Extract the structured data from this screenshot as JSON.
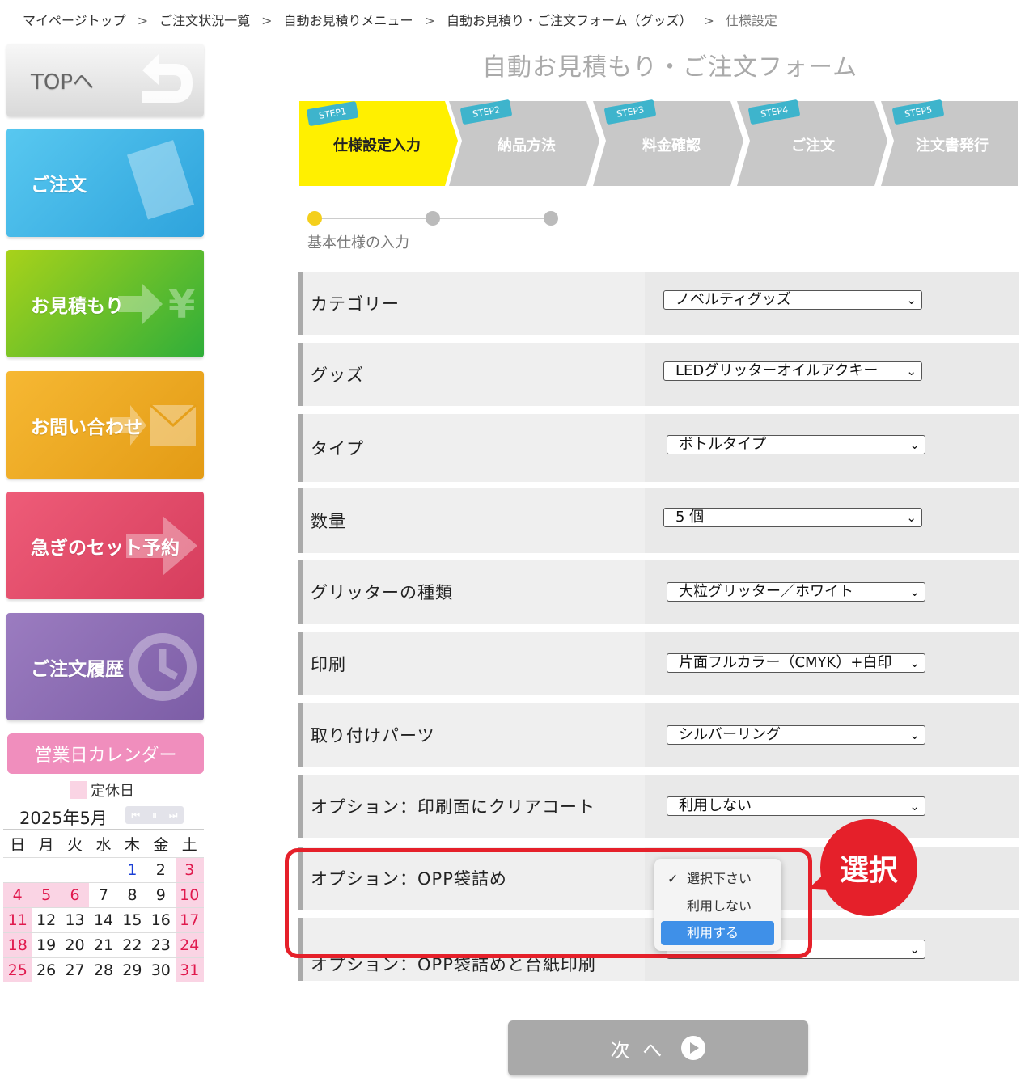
{
  "breadcrumb": {
    "items": [
      "マイページトップ",
      "ご注文状況一覧",
      "自動お見積りメニュー",
      "自動お見積り・ご注文フォーム（グッズ）"
    ],
    "current": "仕様設定",
    "separator": ">"
  },
  "sidebar": {
    "top": "TOPへ",
    "order": "ご注文",
    "quote": "お見積もり",
    "contact": "お問い合わせ",
    "rush": "急ぎのセット予約",
    "history": "ご注文履歴"
  },
  "calendar": {
    "title": "営業日カレンダー",
    "legend": "定休日",
    "month": "2025年5月",
    "nav_icons": [
      "rewind-icon",
      "pause-icon",
      "forward-icon"
    ],
    "weekdays": [
      "日",
      "月",
      "火",
      "水",
      "木",
      "金",
      "土"
    ],
    "weeks": [
      [
        "",
        "",
        "",
        "",
        "1",
        "2",
        "3"
      ],
      [
        "4",
        "5",
        "6",
        "7",
        "8",
        "9",
        "10"
      ],
      [
        "11",
        "12",
        "13",
        "14",
        "15",
        "16",
        "17"
      ],
      [
        "18",
        "19",
        "20",
        "21",
        "22",
        "23",
        "24"
      ],
      [
        "25",
        "26",
        "27",
        "28",
        "29",
        "30",
        "31"
      ]
    ],
    "holidays": [
      "3",
      "4",
      "5",
      "6",
      "10",
      "11",
      "17",
      "18",
      "24",
      "25",
      "31"
    ],
    "blue_days": [
      "1"
    ]
  },
  "form": {
    "title": "自動お見積もり・ご注文フォーム",
    "steps": [
      {
        "tag": "STEP1",
        "label": "仕様設定入力",
        "active": true
      },
      {
        "tag": "STEP2",
        "label": "納品方法",
        "active": false
      },
      {
        "tag": "STEP3",
        "label": "料金確認",
        "active": false
      },
      {
        "tag": "STEP4",
        "label": "ご注文",
        "active": false
      },
      {
        "tag": "STEP5",
        "label": "注文書発行",
        "active": false
      }
    ],
    "substep_caption": "基本仕様の入力",
    "rows": [
      {
        "label": "カテゴリー",
        "value": "ノベルティグッズ"
      },
      {
        "label": "グッズ",
        "value": "LEDグリッターオイルアクキー"
      },
      {
        "label": "タイプ",
        "value": "ボトルタイプ"
      },
      {
        "label": "数量",
        "value": "5 個"
      },
      {
        "label": "グリッターの種類",
        "value": "大粒グリッター／ホワイト"
      },
      {
        "label": "印刷",
        "value": "片面フルカラー（CMYK）+白印"
      },
      {
        "label": "取り付けパーツ",
        "value": "シルバーリング"
      },
      {
        "label": "オプション：印刷面にクリアコート",
        "value": "利用しない"
      },
      {
        "label": "オプション：OPP袋詰め",
        "value": ""
      },
      {
        "label": "オプション：OPP袋詰めと台紙印刷",
        "value": ""
      }
    ],
    "dropdown_options": [
      "選択下さい",
      "利用しない",
      "利用する"
    ],
    "dropdown_checked": "選択下さい",
    "dropdown_highlighted": "利用する",
    "annotation": "選択",
    "next_button": "次 へ"
  },
  "colors": {
    "active_step": "#fff000",
    "inactive_step": "#c8c8c8",
    "highlight": "#e5202a",
    "selected_option": "#3f90e8"
  }
}
